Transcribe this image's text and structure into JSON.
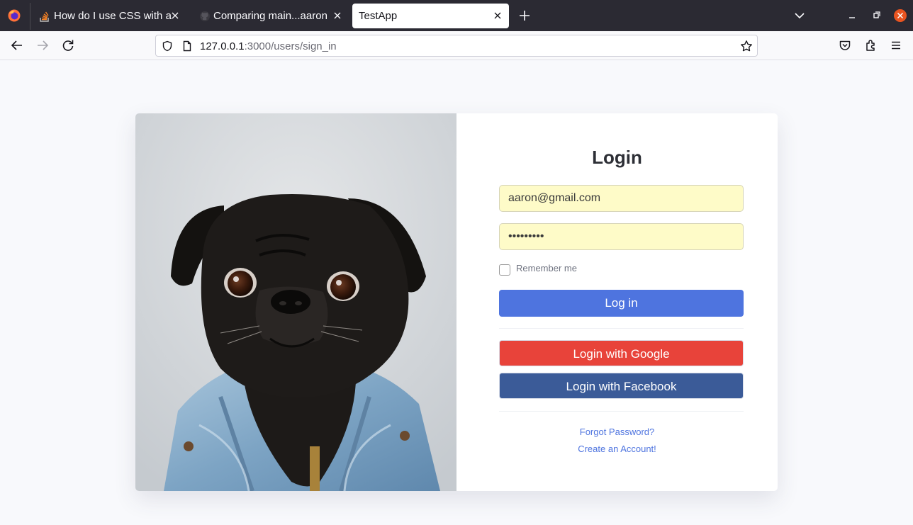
{
  "browser": {
    "tabs": [
      {
        "label": "How do I use CSS with a r",
        "active": false
      },
      {
        "label": "Comparing main...aaron",
        "active": false
      },
      {
        "label": "TestApp",
        "active": true
      }
    ],
    "url": {
      "host": "127.0.0.1",
      "rest": ":3000/users/sign_in"
    },
    "icons": {
      "browser_logo": "firefox-logo-icon",
      "tab1": "stackoverflow-icon",
      "tab2": "github-icon",
      "new_tab": "plus-icon",
      "menu": "chevron-down-icon",
      "window": [
        "minimize-icon",
        "restore-icon",
        "close-icon"
      ],
      "nav": [
        "back-arrow-icon",
        "forward-arrow-icon",
        "reload-icon"
      ],
      "url_left": [
        "shield-icon",
        "page-icon"
      ],
      "url_right": "star-icon",
      "toolbar_right": [
        "pocket-icon",
        "extensions-icon",
        "hamburger-menu-icon"
      ]
    }
  },
  "page": {
    "title": "Login",
    "email_value": "aaron@gmail.com",
    "password_value": "•••••••••",
    "remember_label": "Remember me",
    "login_button": "Log in",
    "google_button": "Login with Google",
    "facebook_button": "Login with Facebook",
    "forgot_link": "Forgot Password?",
    "create_link": "Create an Account!",
    "image": "pug-in-denim-jacket"
  },
  "colors": {
    "primary": "#4e74df",
    "google": "#e8433a",
    "facebook": "#3b5b98",
    "autofill": "#fefbc8",
    "tabbar": "#2b2a33"
  }
}
